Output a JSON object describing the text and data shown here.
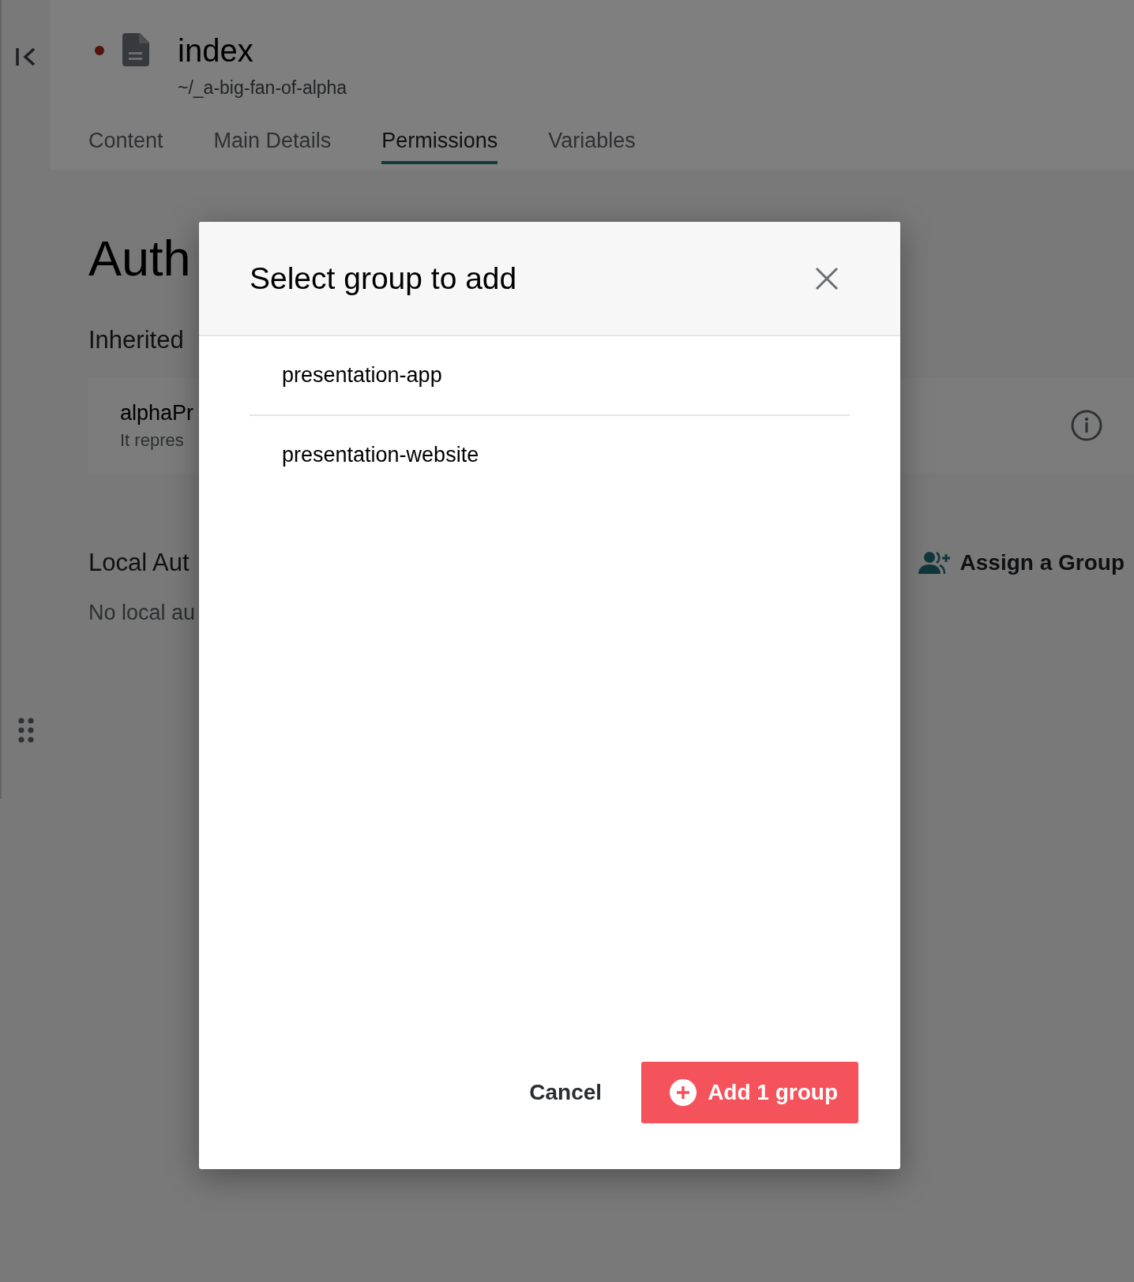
{
  "document": {
    "title": "index",
    "path": "~/_a-big-fan-of-alpha",
    "unsaved": true
  },
  "tabs": [
    {
      "label": "Content",
      "selected": false
    },
    {
      "label": "Main Details",
      "selected": false
    },
    {
      "label": "Permissions",
      "selected": true
    },
    {
      "label": "Variables",
      "selected": false
    }
  ],
  "page": {
    "heading": "Auth",
    "inherited_heading": "Inherited",
    "inherited_groups": [
      {
        "name": "alphaPr",
        "description": "It repres"
      }
    ],
    "local_heading": "Local Aut",
    "assign_button": "Assign a Group",
    "empty_message": "No local au"
  },
  "dialog": {
    "title": "Select group to add",
    "groups": [
      {
        "name": "presentation-app"
      },
      {
        "name": "presentation-website"
      }
    ],
    "cancel": "Cancel",
    "confirm": "Add 1 group"
  }
}
